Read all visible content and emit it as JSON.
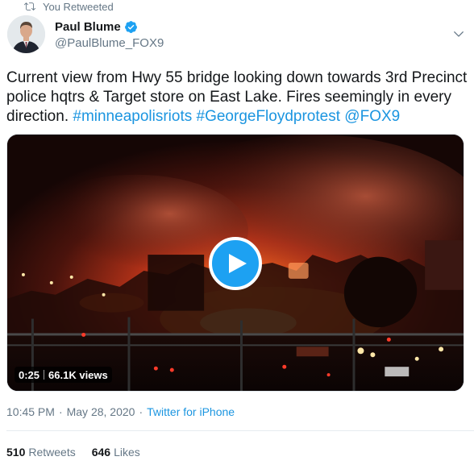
{
  "retweet_banner": {
    "text": "You Retweeted"
  },
  "author": {
    "name": "Paul Blume",
    "handle": "@PaulBlume_FOX9",
    "verified": true
  },
  "tweet": {
    "text_plain": "Current view from Hwy 55 bridge looking down towards 3rd Precinct police hqtrs & Target store on East Lake. Fires seemingly in every direction. ",
    "hashtags": [
      "#minneapolisriots",
      "#GeorgeFloydprotest"
    ],
    "mention": "@FOX9"
  },
  "media": {
    "type": "video",
    "duration": "0:25",
    "views": "66.1K views"
  },
  "meta": {
    "time": "10:45 PM",
    "separator": "·",
    "date": "May 28, 2020",
    "source": "Twitter for iPhone"
  },
  "stats": {
    "retweets_count": "510",
    "retweets_label": "Retweets",
    "likes_count": "646",
    "likes_label": "Likes"
  },
  "colors": {
    "accent": "#1da1f2",
    "link": "#1b95e0",
    "secondary_text": "#657786",
    "primary_text": "#14171a"
  },
  "icons": [
    "retweet-icon",
    "verified-badge-icon",
    "chevron-down-icon",
    "play-icon"
  ]
}
